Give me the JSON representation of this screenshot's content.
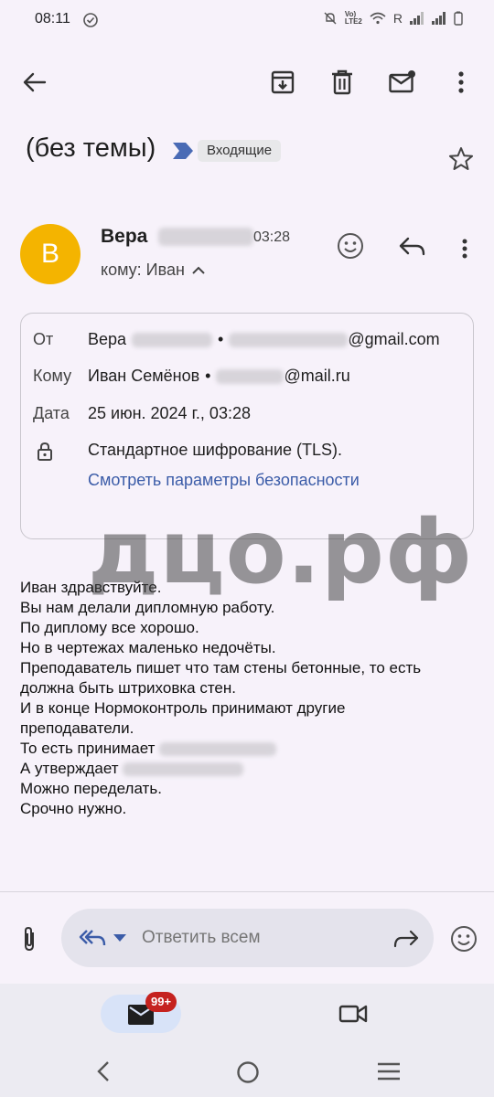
{
  "status_bar": {
    "time": "08:11",
    "network": "R"
  },
  "toolbar": {
    "back": "back-arrow-icon",
    "archive": "archive-icon",
    "delete": "trash-icon",
    "mark_unread": "mail-unread-icon",
    "more": "more-vert-icon"
  },
  "email": {
    "subject": "(без темы)",
    "label": "Входящие",
    "sender": {
      "initial": "В",
      "first_name": "Вера",
      "time": "03:28",
      "recipient_line": "кому: Иван"
    },
    "details": {
      "from_label": "От",
      "from_name": "Вера",
      "from_email_domain": "@gmail.com",
      "to_label": "Кому",
      "to_name": "Иван Семёнов",
      "to_email_domain": "@mail.ru",
      "date_label": "Дата",
      "date_value": "25 июн. 2024 г., 03:28",
      "encryption": "Стандартное шифрование (TLS).",
      "security_link": "Смотреть параметры безопасности"
    },
    "body_lines": [
      "Иван здравствуйте.",
      "Вы нам делали дипломную работу.",
      "По диплому все хорошо.",
      "Но в чертежах маленько недочёты.",
      "Преподаватель пишет что там стены бетонные, то есть",
      "должна быть штриховка стен.",
      "И в конце Нормоконтроль принимают другие",
      "преподаватели.",
      "То есть принимает",
      "А утверждает",
      "Можно переделать.",
      "Срочно нужно."
    ]
  },
  "watermark": "дцо.рф",
  "reply_bar": {
    "placeholder": "Ответить всем"
  },
  "bottom_nav": {
    "mail_badge": "99+"
  },
  "colors": {
    "avatar": "#f4b400",
    "link": "#3b5ca8",
    "badge": "#c5221f",
    "label_arrow": "#4a6bb5"
  }
}
